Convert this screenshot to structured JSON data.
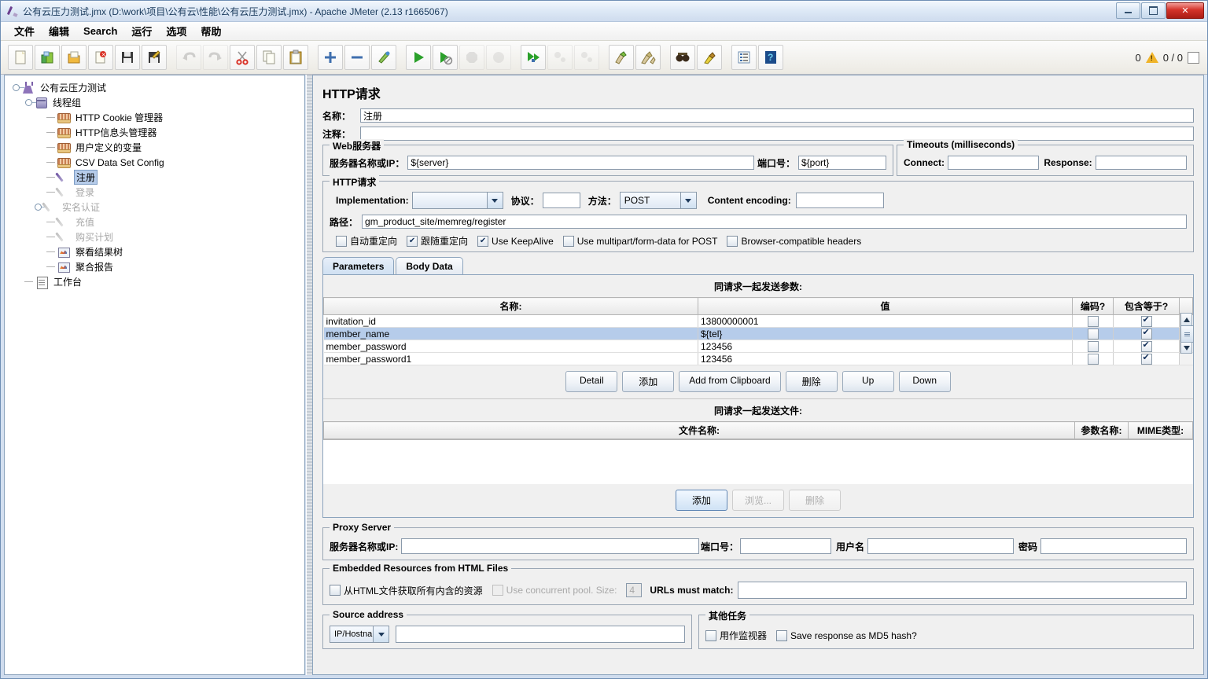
{
  "window": {
    "title": "公有云压力测试.jmx (D:\\work\\项目\\公有云\\性能\\公有云压力测试.jmx) - Apache JMeter (2.13 r1665067)",
    "minimize": "–",
    "maximize": "□",
    "close": "✕"
  },
  "menu": [
    "文件",
    "编辑",
    "Search",
    "运行",
    "选项",
    "帮助"
  ],
  "toolbar": {
    "buttons": [
      {
        "name": "new-icon",
        "enabled": true
      },
      {
        "name": "templates-icon",
        "enabled": true
      },
      {
        "name": "open-icon",
        "enabled": true
      },
      {
        "name": "close-icon",
        "enabled": true
      },
      {
        "name": "save-icon",
        "enabled": true
      },
      {
        "name": "save-as-icon",
        "enabled": true
      },
      {
        "name": "undo-icon",
        "enabled": false
      },
      {
        "name": "redo-icon",
        "enabled": false
      },
      {
        "name": "cut-icon",
        "enabled": true
      },
      {
        "name": "copy-icon",
        "enabled": true
      },
      {
        "name": "paste-icon",
        "enabled": true
      },
      {
        "name": "expand-all-icon",
        "enabled": true
      },
      {
        "name": "collapse-all-icon",
        "enabled": true
      },
      {
        "name": "toggle-icon",
        "enabled": true
      },
      {
        "name": "start-icon",
        "enabled": true
      },
      {
        "name": "start-no-timers-icon",
        "enabled": true
      },
      {
        "name": "stop-icon",
        "enabled": false
      },
      {
        "name": "shutdown-icon",
        "enabled": false
      },
      {
        "name": "start-remote-all-icon",
        "enabled": true
      },
      {
        "name": "stop-remote-all-icon",
        "enabled": false
      },
      {
        "name": "shutdown-remote-all-icon",
        "enabled": false
      },
      {
        "name": "clear-icon",
        "enabled": true
      },
      {
        "name": "clear-all-icon",
        "enabled": true
      },
      {
        "name": "search-icon",
        "enabled": true
      },
      {
        "name": "reset-search-icon",
        "enabled": true
      },
      {
        "name": "function-helper-icon",
        "enabled": true
      },
      {
        "name": "help-icon",
        "enabled": true
      }
    ],
    "warning_count": "0",
    "thread_counter": "0 / 0"
  },
  "tree": {
    "nodes": [
      {
        "label": "公有云压力测试",
        "icon": "test-plan-icon",
        "depth": 0,
        "dim": false,
        "selected": false,
        "handle": true
      },
      {
        "label": "线程组",
        "icon": "thread-group-icon",
        "depth": 1,
        "dim": false,
        "selected": false,
        "handle": true
      },
      {
        "label": "HTTP Cookie 管理器",
        "icon": "config-element-icon",
        "depth": 2,
        "dim": false,
        "selected": false,
        "handle": false
      },
      {
        "label": "HTTP信息头管理器",
        "icon": "config-element-icon",
        "depth": 2,
        "dim": false,
        "selected": false,
        "handle": false
      },
      {
        "label": "用户定义的变量",
        "icon": "config-element-icon",
        "depth": 2,
        "dim": false,
        "selected": false,
        "handle": false
      },
      {
        "label": "CSV Data Set Config",
        "icon": "config-element-icon",
        "depth": 2,
        "dim": false,
        "selected": false,
        "handle": false
      },
      {
        "label": "注册",
        "icon": "http-sampler-icon",
        "depth": 2,
        "dim": false,
        "selected": true,
        "handle": false
      },
      {
        "label": "登录",
        "icon": "http-sampler-icon",
        "depth": 2,
        "dim": true,
        "selected": false,
        "handle": false
      },
      {
        "label": "实名认证",
        "icon": "http-sampler-icon",
        "depth": 2,
        "dim": true,
        "selected": false,
        "handle": true
      },
      {
        "label": "充值",
        "icon": "http-sampler-icon",
        "depth": 2,
        "dim": true,
        "selected": false,
        "handle": false
      },
      {
        "label": "购买计划",
        "icon": "http-sampler-icon",
        "depth": 2,
        "dim": true,
        "selected": false,
        "handle": false
      },
      {
        "label": "察看结果树",
        "icon": "listener-icon",
        "depth": 2,
        "dim": false,
        "selected": false,
        "handle": false
      },
      {
        "label": "聚合报告",
        "icon": "listener-icon",
        "depth": 2,
        "dim": false,
        "selected": false,
        "handle": false
      },
      {
        "label": "工作台",
        "icon": "workbench-icon",
        "depth": 0,
        "dim": false,
        "selected": false,
        "handle": false
      }
    ]
  },
  "main": {
    "title": "HTTP请求",
    "name_label": "名称：",
    "name_value": "注册",
    "comment_label": "注释：",
    "comment_value": "",
    "web_server": {
      "group_title": "Web服务器",
      "server_label": "服务器名称或IP：",
      "server_value": "${server}",
      "port_label": "端口号：",
      "port_value": "${port}"
    },
    "timeouts": {
      "group_title": "Timeouts (milliseconds)",
      "connect_label": "Connect:",
      "connect_value": "",
      "response_label": "Response:",
      "response_value": ""
    },
    "http_request": {
      "group_title": "HTTP请求",
      "implementation_label": "Implementation:",
      "implementation_value": "",
      "protocol_label": "协议：",
      "protocol_value": "",
      "method_label": "方法：",
      "method_value": "POST",
      "content_encoding_label": "Content encoding:",
      "content_encoding_value": "",
      "path_label": "路径：",
      "path_value": "gm_product_site/memreg/register",
      "checkboxes": [
        {
          "label": "自动重定向",
          "checked": false
        },
        {
          "label": "跟随重定向",
          "checked": true
        },
        {
          "label": "Use KeepAlive",
          "checked": true
        },
        {
          "label": "Use multipart/form-data for POST",
          "checked": false
        },
        {
          "label": "Browser-compatible headers",
          "checked": false
        }
      ]
    },
    "tabs": [
      {
        "label": "Parameters",
        "active": true
      },
      {
        "label": "Body Data",
        "active": false
      }
    ],
    "params_table": {
      "caption": "同请求一起发送参数:",
      "columns": [
        "名称:",
        "值",
        "编码?",
        "包含等于?"
      ],
      "rows": [
        {
          "name": "invitation_id",
          "value": "13800000001",
          "encode": false,
          "include_equals": true,
          "selected": false
        },
        {
          "name": "member_name",
          "value": "${tel}",
          "encode": false,
          "include_equals": true,
          "selected": true
        },
        {
          "name": "member_password",
          "value": "123456",
          "encode": false,
          "include_equals": true,
          "selected": false
        },
        {
          "name": "member_password1",
          "value": "123456",
          "encode": false,
          "include_equals": true,
          "selected": false
        }
      ],
      "buttons": [
        "Detail",
        "添加",
        "Add from Clipboard",
        "删除",
        "Up",
        "Down"
      ]
    },
    "files_table": {
      "caption": "同请求一起发送文件:",
      "columns": [
        "文件名称:",
        "参数名称:",
        "MIME类型:"
      ],
      "rows": [],
      "buttons": [
        {
          "label": "添加",
          "enabled": true,
          "primary": true
        },
        {
          "label": "浏览...",
          "enabled": false,
          "primary": false
        },
        {
          "label": "删除",
          "enabled": false,
          "primary": false
        }
      ]
    },
    "proxy_server": {
      "group_title": "Proxy Server",
      "server_label": "服务器名称或IP:",
      "server_value": "",
      "port_label": "端口号：",
      "port_value": "",
      "username_label": "用户名",
      "username_value": "",
      "password_label": "密码",
      "password_value": ""
    },
    "embedded": {
      "group_title": "Embedded Resources from HTML Files",
      "retrieve_label": "从HTML文件获取所有内含的资源",
      "retrieve_checked": false,
      "pool_label": "Use concurrent pool. Size:",
      "pool_checked": false,
      "pool_size": "4",
      "urls_label": "URLs must match:",
      "urls_value": ""
    },
    "source_address": {
      "group_title": "Source address",
      "type_value": "IP/Hostname",
      "value": ""
    },
    "other_tasks": {
      "group_title": "其他任务",
      "monitor_label": "用作监视器",
      "monitor_checked": false,
      "md5_label": "Save response as MD5 hash?",
      "md5_checked": false
    }
  }
}
